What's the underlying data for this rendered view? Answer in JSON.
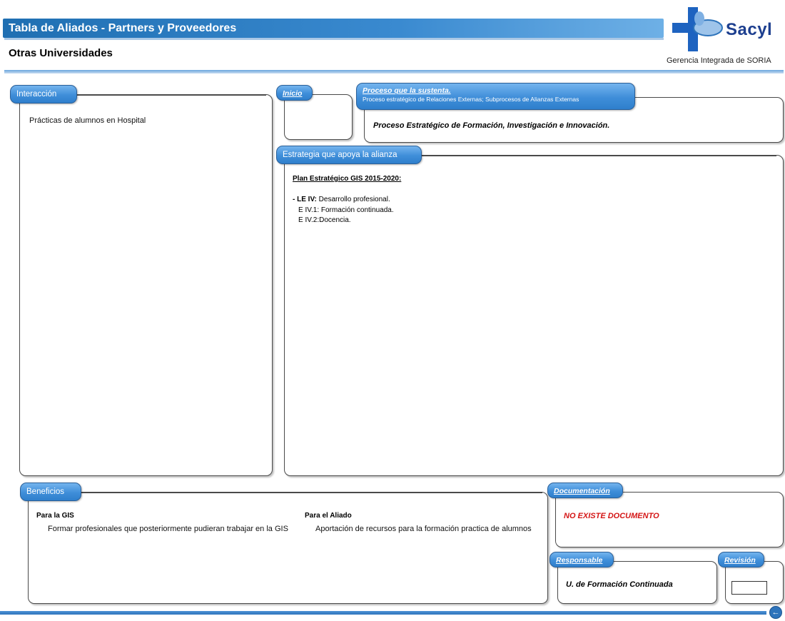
{
  "header": {
    "title": "Tabla de Aliados - Partners y Proveedores",
    "subtitle": "Otras Universidades",
    "logo_name": "Sacyl",
    "logo_caption": "Gerencia Integrada de SORIA",
    "logo_icon": "sacyl-cross-icon"
  },
  "interaccion": {
    "label": "Interacción",
    "text": "Prácticas de alumnos en Hospital"
  },
  "inicio": {
    "label": "Inicio",
    "text": ""
  },
  "proceso": {
    "label": "Proceso que la sustenta.",
    "sublabel": "Proceso estratégico de Relaciones Externas; Subprocesos de Alianzas Externas",
    "text": "Proceso Estratégico de Formación, Investigación e Innovación."
  },
  "estrategia": {
    "label": "Estrategia que apoya la alianza",
    "heading": "Plan Estratégico GIS 2015-2020:",
    "line1_prefix": "- LE IV:",
    "line1_text": " Desarrollo profesional.",
    "line2": "E IV.1: Formación continuada.",
    "line3": "E IV.2:Docencia."
  },
  "beneficios": {
    "label": "Beneficios",
    "gis_heading": "Para la GIS",
    "gis_text": "Formar profesionales que posteriormente pudieran trabajar en la GIS",
    "aliado_heading": "Para el Aliado",
    "aliado_text": "Aportación de recursos para la formación practica de alumnos"
  },
  "documentacion": {
    "label": "Documentación",
    "text": "NO EXISTE DOCUMENTO"
  },
  "responsable": {
    "label": "Responsable",
    "text": "U. de Formación Continuada"
  },
  "revision": {
    "label": "Revisión",
    "value": ""
  },
  "footer": {
    "back_icon": "back-arrow-icon"
  },
  "colors": {
    "title_bar": "#1f6fb2",
    "tab_blue": "#3f8ed9",
    "logo_blue": "#1d3f8f",
    "alert_red": "#d41515"
  }
}
